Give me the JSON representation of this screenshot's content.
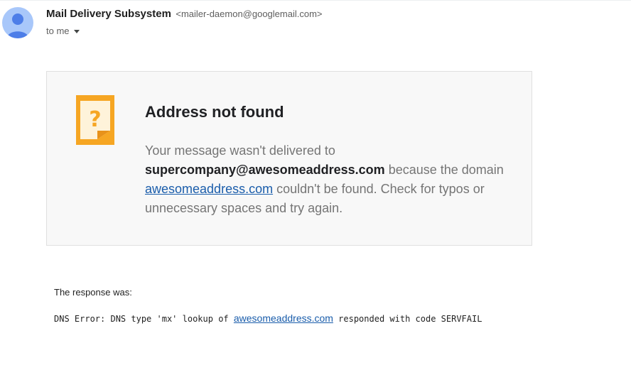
{
  "header": {
    "sender_name": "Mail Delivery Subsystem",
    "sender_email": "<mailer-daemon@googlemail.com>",
    "recipient": "to me",
    "avatar_icon": "person-icon"
  },
  "notice": {
    "icon": "question-note-icon",
    "title": "Address not found",
    "body_part1": "Your message wasn't delivered to ",
    "address": "supercompany@awesomeaddress.com",
    "body_part2": " because the domain ",
    "domain_link": "awesomeaddress.com",
    "body_part3": " couldn't be found. Check for typos or unnecessary spaces and try again."
  },
  "response": {
    "label": "The response was:",
    "code_prefix": "DNS Error: DNS type 'mx' lookup of ",
    "code_link": "awesomeaddress.com",
    "code_suffix": " responded with code SERVFAIL"
  },
  "colors": {
    "avatar_bg": "#a8c7fa",
    "avatar_fg": "#4d7ee8",
    "card_bg": "#f8f8f8",
    "link": "#1a5dab",
    "icon_orange": "#f6a623",
    "icon_sheet": "#fef3da"
  }
}
